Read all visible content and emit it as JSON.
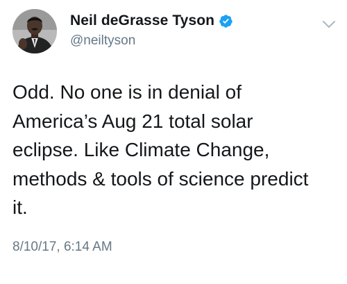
{
  "tweet": {
    "author": {
      "display_name": "Neil deGrasse Tyson",
      "handle": "@neiltyson",
      "verified": true,
      "avatar": "profile-photo"
    },
    "text": "Odd. No one is in denial of\nAmerica’s Aug 21 total solar\neclipse. Like Climate Change,\nmethods & tools of science predict\nit.",
    "timestamp": "8/10/17, 6:14 AM"
  },
  "icons": {
    "verified": "verified-badge-icon",
    "menu": "chevron-down-icon"
  },
  "colors": {
    "verified_blue": "#1da1f2",
    "secondary_text": "#657786",
    "primary_text": "#14171a"
  }
}
